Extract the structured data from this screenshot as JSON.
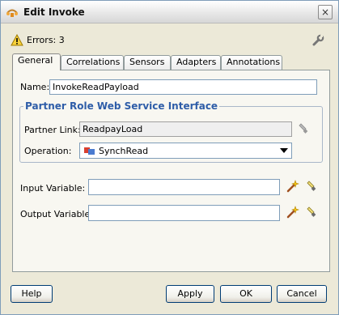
{
  "window": {
    "title": "Edit Invoke",
    "close_label": "×"
  },
  "errors": {
    "text": "Errors: 3"
  },
  "tabs": [
    {
      "label": "General",
      "active": true
    },
    {
      "label": "Correlations"
    },
    {
      "label": "Sensors"
    },
    {
      "label": "Adapters"
    },
    {
      "label": "Annotations"
    }
  ],
  "general": {
    "name_label": "Name:",
    "name_value": "InvokeReadPayload",
    "group_title": "Partner Role Web Service Interface",
    "partner_link_label": "Partner Link:",
    "partner_link_value": "ReadpayLoad",
    "operation_label": "Operation:",
    "operation_value": "SynchRead",
    "input_variable_label": "Input Variable:",
    "input_variable_value": "",
    "output_variable_label": "Output Variable:",
    "output_variable_value": ""
  },
  "buttons": {
    "help": "Help",
    "apply": "Apply",
    "ok": "OK",
    "cancel": "Cancel"
  },
  "icons": {
    "title": "bpel-invoke-icon",
    "warning": "warning-icon",
    "wrench": "wrench-icon",
    "flashlight": "flashlight-icon",
    "add_variable": "add-variable-icon"
  }
}
